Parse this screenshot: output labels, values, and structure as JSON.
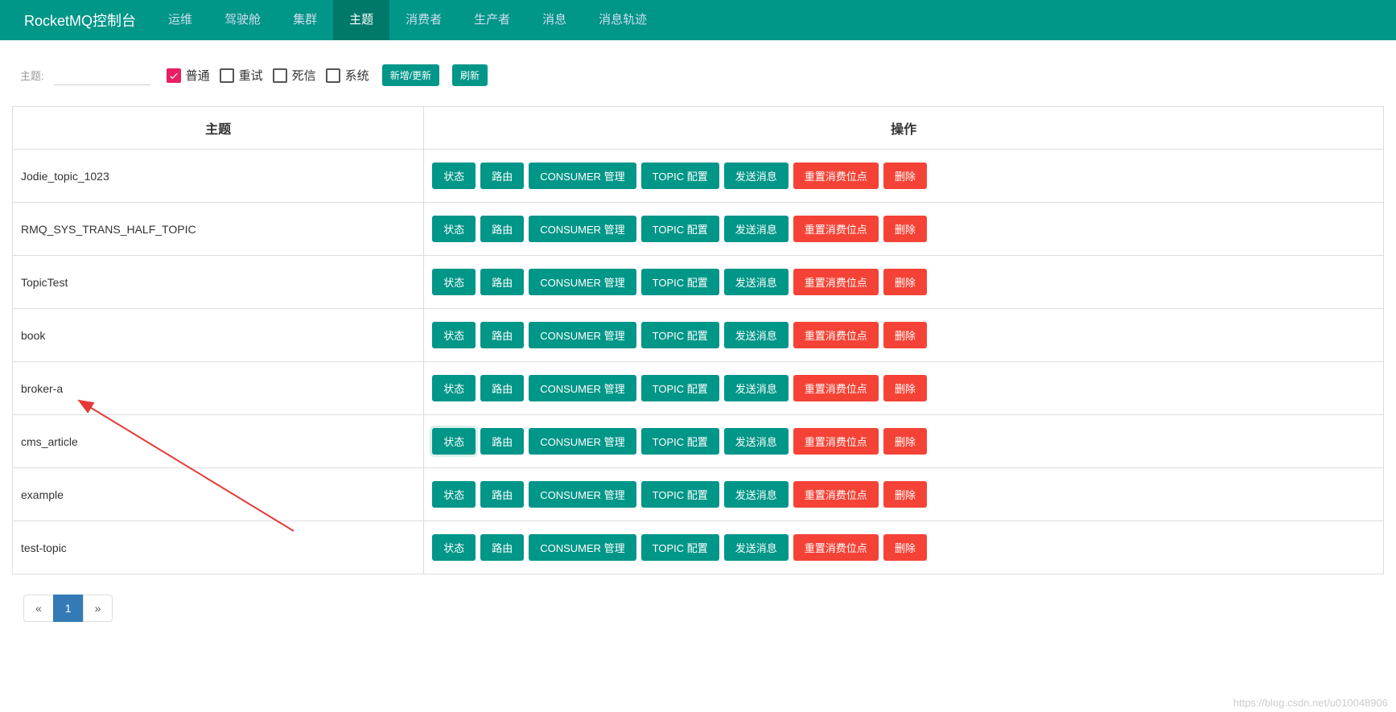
{
  "navbar": {
    "brand": "RocketMQ控制台",
    "items": [
      {
        "label": "运维"
      },
      {
        "label": "驾驶舱"
      },
      {
        "label": "集群"
      },
      {
        "label": "主题",
        "active": true
      },
      {
        "label": "消费者"
      },
      {
        "label": "生产者"
      },
      {
        "label": "消息"
      },
      {
        "label": "消息轨迹"
      }
    ]
  },
  "filter": {
    "label": "主题:",
    "value": "",
    "checkboxes": [
      {
        "label": "普通",
        "checked": true
      },
      {
        "label": "重试",
        "checked": false
      },
      {
        "label": "死信",
        "checked": false
      },
      {
        "label": "系统",
        "checked": false
      }
    ],
    "add_update": "新增/更新",
    "refresh": "刷新"
  },
  "table": {
    "headers": {
      "topic": "主题",
      "operation": "操作"
    },
    "op_labels": {
      "status": "状态",
      "route": "路由",
      "consumer": "CONSUMER 管理",
      "topic_config": "TOPIC 配置",
      "send": "发送消息",
      "reset": "重置消费位点",
      "delete": "删除"
    },
    "rows": [
      {
        "name": "Jodie_topic_1023"
      },
      {
        "name": "RMQ_SYS_TRANS_HALF_TOPIC"
      },
      {
        "name": "TopicTest"
      },
      {
        "name": "book"
      },
      {
        "name": "broker-a"
      },
      {
        "name": "cms_article",
        "highlighted": true
      },
      {
        "name": "example"
      },
      {
        "name": "test-topic"
      }
    ]
  },
  "pagination": {
    "prev": "«",
    "next": "»",
    "current": "1"
  },
  "watermark": "https://blog.csdn.net/u010048906"
}
